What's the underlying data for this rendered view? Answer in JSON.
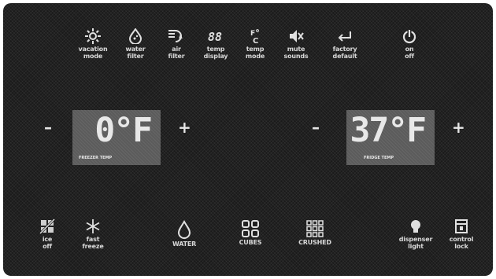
{
  "top_controls": [
    {
      "label": "vacation\nmode",
      "icon": "sun-icon"
    },
    {
      "label": "water\nfilter",
      "icon": "water-drop-icon"
    },
    {
      "label": "air\nfilter",
      "icon": "air-filter-icon"
    },
    {
      "label": "temp\ndisplay",
      "icon": "digits-icon"
    },
    {
      "label": "temp\nmode",
      "icon": "fahrenheit-celsius-icon"
    },
    {
      "label": "mute\nsounds",
      "icon": "speaker-mute-icon"
    },
    {
      "label": "factory\ndefault",
      "icon": "return-arrow-icon"
    },
    {
      "label": "on\noff",
      "icon": "power-icon"
    }
  ],
  "freezer": {
    "value": "0°F",
    "label": "FREEZER TEMP",
    "minus": "–",
    "plus": "+"
  },
  "fridge": {
    "value": "37°F",
    "label": "FRIDGE TEMP",
    "minus": "–",
    "plus": "+"
  },
  "bottom_controls": [
    {
      "label": "ice\noff",
      "icon": "ice-off-icon"
    },
    {
      "label": "fast\nfreeze",
      "icon": "snowflake-icon"
    },
    {
      "label": "WATER",
      "icon": "water-drop-icon"
    },
    {
      "label": "CUBES",
      "icon": "cubes-icon"
    },
    {
      "label": "CRUSHED",
      "icon": "crushed-ice-icon"
    },
    {
      "label": "dispenser\nlight",
      "icon": "light-bulb-icon"
    },
    {
      "label": "control\nlock",
      "icon": "lock-icon"
    }
  ],
  "colors": {
    "panel": "#1a1a1a",
    "display": "#5b5b5b",
    "text": "#d8d8d8"
  }
}
